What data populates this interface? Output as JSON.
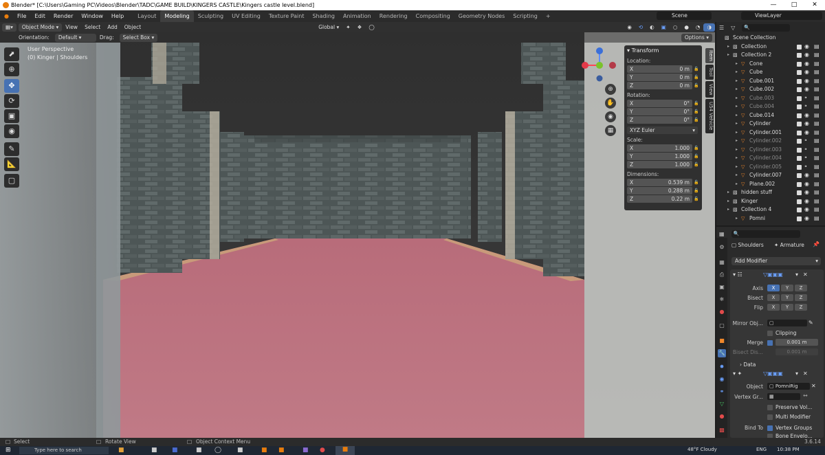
{
  "titlebar": {
    "title": "Blender* [C:\\Users\\Gaming PC\\Videos\\Blender\\TADC\\GAME BUILD\\KINGERS CASTLE\\Kingers castle level.blend]"
  },
  "menu": [
    "File",
    "Edit",
    "Render",
    "Window",
    "Help"
  ],
  "workspaces": [
    "Layout",
    "Modeling",
    "Sculpting",
    "UV Editing",
    "Texture Paint",
    "Shading",
    "Animation",
    "Rendering",
    "Compositing",
    "Geometry Nodes",
    "Scripting"
  ],
  "active_workspace": "Modeling",
  "scene": {
    "scene_name": "Scene",
    "view_layer": "ViewLayer"
  },
  "header": {
    "mode": "Object Mode",
    "view": "View",
    "select": "Select",
    "add": "Add",
    "object": "Object",
    "orientation_global": "Global"
  },
  "toolheader": {
    "orientation_label": "Orientation:",
    "orientation_value": "Default",
    "drag_label": "Drag:",
    "drag_value": "Select Box",
    "options": "Options"
  },
  "viewport": {
    "perspective": "User Perspective",
    "context": "(0) Kinger | Shoulders"
  },
  "npanel": {
    "title": "Transform",
    "location_label": "Location:",
    "location": [
      {
        "axis": "X",
        "value": "0 m"
      },
      {
        "axis": "Y",
        "value": "0 m"
      },
      {
        "axis": "Z",
        "value": "0 m"
      }
    ],
    "rotation_label": "Rotation:",
    "rotation": [
      {
        "axis": "X",
        "value": "0°"
      },
      {
        "axis": "Y",
        "value": "0°"
      },
      {
        "axis": "Z",
        "value": "0°"
      }
    ],
    "rotation_mode": "XYZ Euler",
    "scale_label": "Scale:",
    "scale": [
      {
        "axis": "X",
        "value": "1.000"
      },
      {
        "axis": "Y",
        "value": "1.000"
      },
      {
        "axis": "Z",
        "value": "1.000"
      }
    ],
    "dimensions_label": "Dimensions:",
    "dimensions": [
      {
        "axis": "X",
        "value": "0.539 m"
      },
      {
        "axis": "Y",
        "value": "0.288 m"
      },
      {
        "axis": "Z",
        "value": "0.22 m"
      }
    ]
  },
  "side_tabs": [
    "Item",
    "Tool",
    "View",
    "U54 Vehicle"
  ],
  "outliner": {
    "root": "Scene Collection",
    "items": [
      {
        "name": "Collection",
        "indent": 1,
        "dim": false
      },
      {
        "name": "Collection 2",
        "indent": 1,
        "dim": false
      },
      {
        "name": "Cone",
        "indent": 2,
        "dim": false
      },
      {
        "name": "Cube",
        "indent": 2,
        "dim": false
      },
      {
        "name": "Cube.001",
        "indent": 2,
        "dim": false
      },
      {
        "name": "Cube.002",
        "indent": 2,
        "dim": false
      },
      {
        "name": "Cube.003",
        "indent": 2,
        "dim": true
      },
      {
        "name": "Cube.004",
        "indent": 2,
        "dim": true
      },
      {
        "name": "Cube.014",
        "indent": 2,
        "dim": false
      },
      {
        "name": "Cylinder",
        "indent": 2,
        "dim": false
      },
      {
        "name": "Cylinder.001",
        "indent": 2,
        "dim": false
      },
      {
        "name": "Cylinder.002",
        "indent": 2,
        "dim": true
      },
      {
        "name": "Cylinder.003",
        "indent": 2,
        "dim": true
      },
      {
        "name": "Cylinder.004",
        "indent": 2,
        "dim": true
      },
      {
        "name": "Cylinder.005",
        "indent": 2,
        "dim": true
      },
      {
        "name": "Cylinder.007",
        "indent": 2,
        "dim": false
      },
      {
        "name": "Plane.002",
        "indent": 2,
        "dim": false
      },
      {
        "name": "hidden stuff",
        "indent": 1,
        "dim": false
      },
      {
        "name": "Kinger",
        "indent": 1,
        "dim": false
      },
      {
        "name": "Collection 4",
        "indent": 1,
        "dim": false
      },
      {
        "name": "Pomni",
        "indent": 2,
        "dim": false
      }
    ]
  },
  "properties": {
    "object_name": "Shoulders",
    "data_name": "Armature",
    "add_modifier": "Add Modifier",
    "mirror": {
      "axis_label": "Axis",
      "bisect_label": "Bisect",
      "flip_label": "Flip",
      "mirror_object_label": "Mirror Obj...",
      "clipping_label": "Clipping",
      "merge_label": "Merge",
      "merge_value": "0.001 m",
      "bisect_dist_label": "Bisect Dis...",
      "bisect_dist_value": "0.001 m",
      "data_label": "Data",
      "x": "X",
      "y": "Y",
      "z": "Z"
    },
    "armature": {
      "object_label": "Object",
      "object_value": "PomniRig",
      "vertex_group_label": "Vertex Gr...",
      "preserve_volume": "Preserve Vol...",
      "multi_modifier": "Multi Modifier",
      "bind_to_label": "Bind To",
      "vertex_groups": "Vertex Groups",
      "bone_envelopes": "Bone Envelo..."
    }
  },
  "statusbar": {
    "select": "Select",
    "rotate_view": "Rotate View",
    "context_menu": "Object Context Menu",
    "version": "3.6.14"
  },
  "taskbar": {
    "search": "Type here to search",
    "weather": "48°F Cloudy",
    "language": "ENG",
    "time": "10:38 PM"
  }
}
